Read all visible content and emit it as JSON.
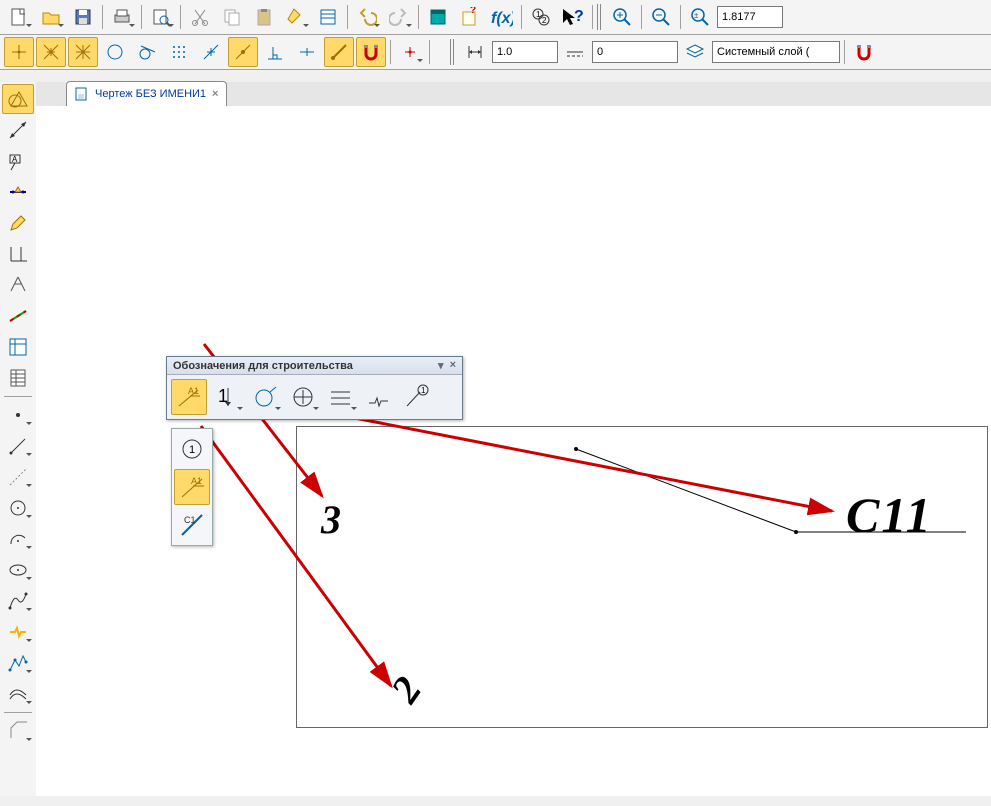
{
  "top_toolbar1": {
    "zoom_value": "1.8177"
  },
  "top_toolbar2": {
    "field1": "1.0",
    "field2": "0",
    "layer": "Системный слой ("
  },
  "tab": {
    "title": "Чертеж БЕЗ ИМЕНИ1"
  },
  "float_panel": {
    "title": "Обозначения для строительства"
  },
  "canvas_labels": {
    "n3": "3",
    "n2": "2",
    "c11": "С11"
  }
}
